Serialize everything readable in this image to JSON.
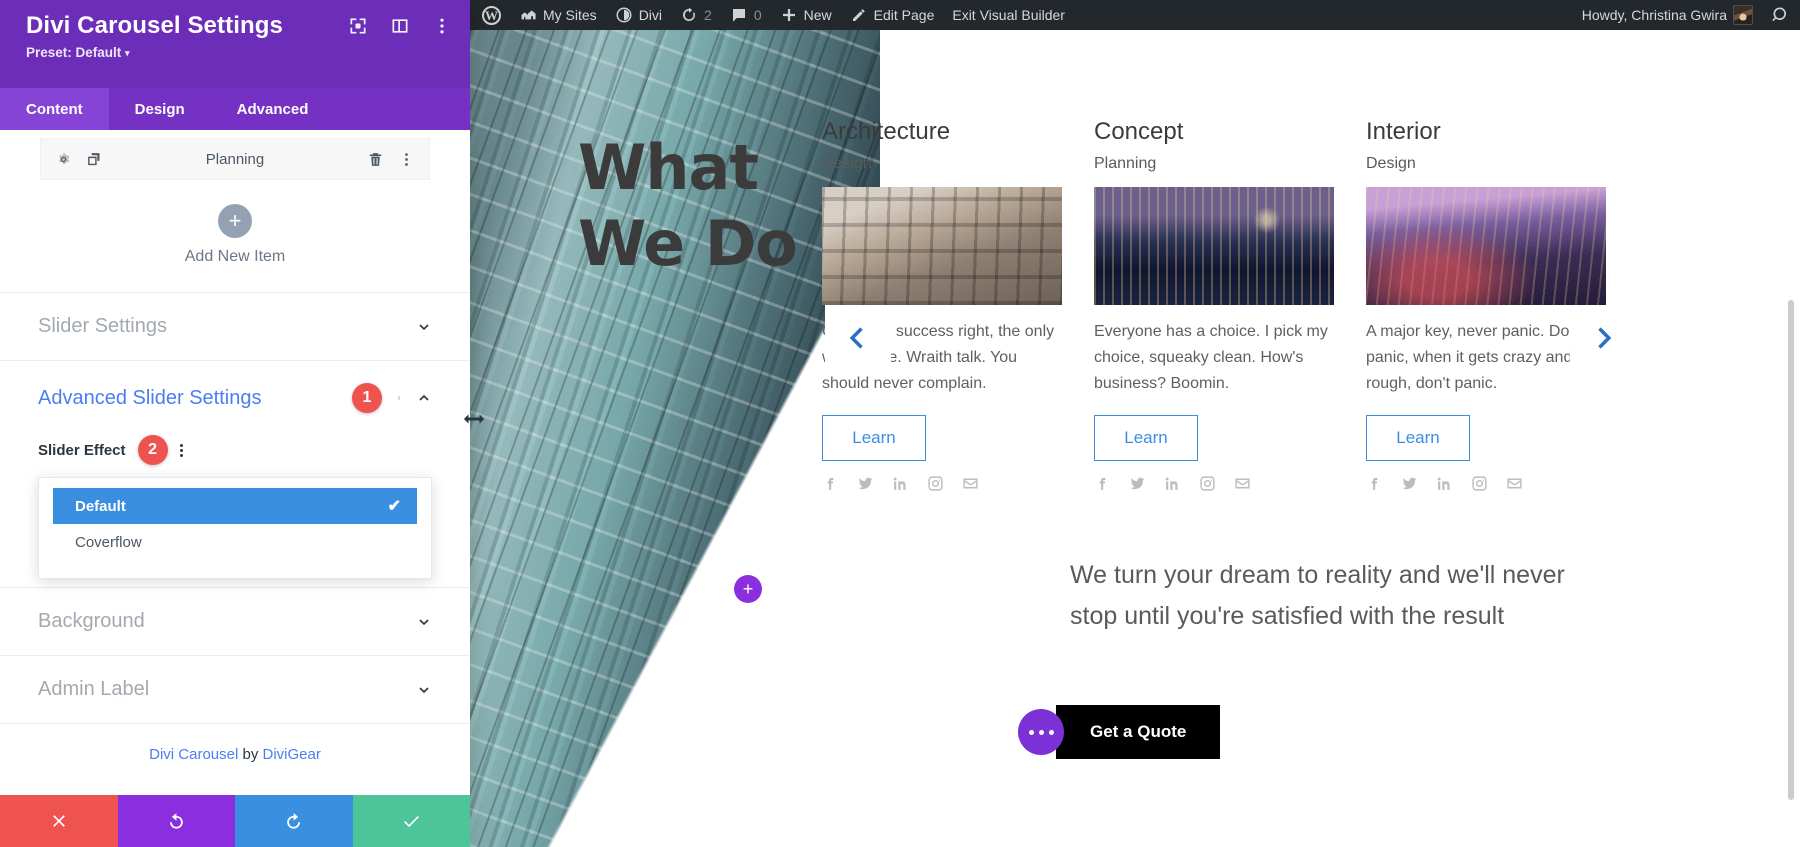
{
  "adminbar": {
    "items": [
      {
        "name": "wordpress-logo",
        "label": ""
      },
      {
        "name": "my-sites",
        "label": "My Sites"
      },
      {
        "name": "divi",
        "label": "Divi"
      },
      {
        "name": "updates",
        "label": "2"
      },
      {
        "name": "comments",
        "label": "0"
      },
      {
        "name": "new",
        "label": "New"
      },
      {
        "name": "edit-page",
        "label": "Edit Page"
      },
      {
        "name": "exit-visual-builder",
        "label": "Exit Visual Builder"
      }
    ],
    "my_sites": "My Sites",
    "divi": "Divi",
    "updates_count": "2",
    "comments_count": "0",
    "new": "New",
    "edit_page": "Edit Page",
    "exit_visual_builder": "Exit Visual Builder",
    "howdy": "Howdy, Christina Gwira"
  },
  "panel": {
    "title": "Divi Carousel Settings",
    "preset": "Preset: Default",
    "preset_caret": "▾",
    "tabs": [
      {
        "label": "Content",
        "active": true
      },
      {
        "label": "Design",
        "active": false
      },
      {
        "label": "Advanced",
        "active": false
      }
    ],
    "tab_content": "Content",
    "tab_design": "Design",
    "tab_advanced": "Advanced",
    "item_row": {
      "label": "Planning"
    },
    "add_new_item": "Add New Item",
    "add_plus": "+",
    "sections": [
      {
        "label": "Slider Settings",
        "open": false
      },
      {
        "label": "Advanced Slider Settings",
        "open": true,
        "badge": "1"
      },
      {
        "label": "Background",
        "open": false
      },
      {
        "label": "Admin Label",
        "open": false
      }
    ],
    "slider_settings_label": "Slider Settings",
    "advanced_slider_settings_label": "Advanced Slider Settings",
    "advanced_badge": "1",
    "background_label": "Background",
    "admin_label_label": "Admin Label",
    "field": {
      "label": "Slider Effect",
      "badge": "2",
      "options": [
        {
          "label": "Default",
          "selected": true
        },
        {
          "label": "Coverflow",
          "selected": false
        }
      ],
      "option_default": "Default",
      "option_coverflow": "Coverflow",
      "check_glyph": "✔"
    },
    "credit": {
      "product": "Divi Carousel",
      "by": " by ",
      "vendor": "DiviGear"
    },
    "actions": [
      {
        "name": "cancel-button",
        "color": "#ef5350"
      },
      {
        "name": "undo-button",
        "color": "#8b2ee0"
      },
      {
        "name": "redo-button",
        "color": "#3a8fe0"
      },
      {
        "name": "save-button",
        "color": "#4ec49a"
      }
    ]
  },
  "page": {
    "hero_heading_line1": "What",
    "hero_heading_line2": "We Do",
    "cards": [
      {
        "title": "Architecture",
        "subtitle": "Design",
        "body": " Celebrate success right, the only way, apple. Wraith talk. You should never complain.",
        "button": "Learn",
        "image": "architecture-building-photo"
      },
      {
        "title": "Concept",
        "subtitle": "Planning",
        "body": "Everyone has a choice. I pick my choice, squeaky clean. How's business? Boomin.",
        "button": "Learn",
        "image": "city-skyline-night-photo"
      },
      {
        "title": "Interior",
        "subtitle": "Design",
        "body": "A major key, never panic. Don't panic, when it gets crazy and rough, don't panic.",
        "button": "Learn",
        "image": "city-street-dusk-photo"
      }
    ],
    "social_icons": [
      "facebook-icon",
      "twitter-icon",
      "linkedin-icon",
      "instagram-icon",
      "email-icon"
    ],
    "tagline": "We turn your dream to reality and we'll never stop until you're satisfied with the result",
    "quote_button": "Get a Quote",
    "nav_prev": "‹",
    "nav_next": "›",
    "plus_glyph": "+"
  },
  "colors": {
    "panel_header": "#6c2eb9",
    "tabs_bg": "#7431c4",
    "tab_active": "#8544d6",
    "badge_red": "#ef5350",
    "accent_blue": "#3a8fe0",
    "link_blue": "#4c7cf3",
    "save_green": "#4ec49a",
    "adminbar": "#23282d"
  }
}
